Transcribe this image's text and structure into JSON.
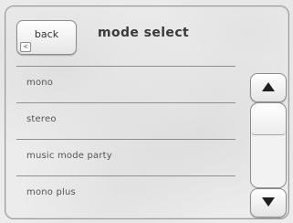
{
  "header": {
    "back_label": "back",
    "back_hint": "<",
    "title": "mode select"
  },
  "list": {
    "items": [
      {
        "label": "mono"
      },
      {
        "label": "stereo"
      },
      {
        "label": "music mode party"
      },
      {
        "label": "mono plus"
      }
    ]
  },
  "scrollbar": {
    "up_icon": "triangle-up-icon",
    "down_icon": "triangle-down-icon",
    "position_fraction": 0.0
  },
  "colors": {
    "background": "#ececec",
    "border": "#8d8d8d",
    "text": "#555555",
    "title": "#3a3a3a"
  }
}
